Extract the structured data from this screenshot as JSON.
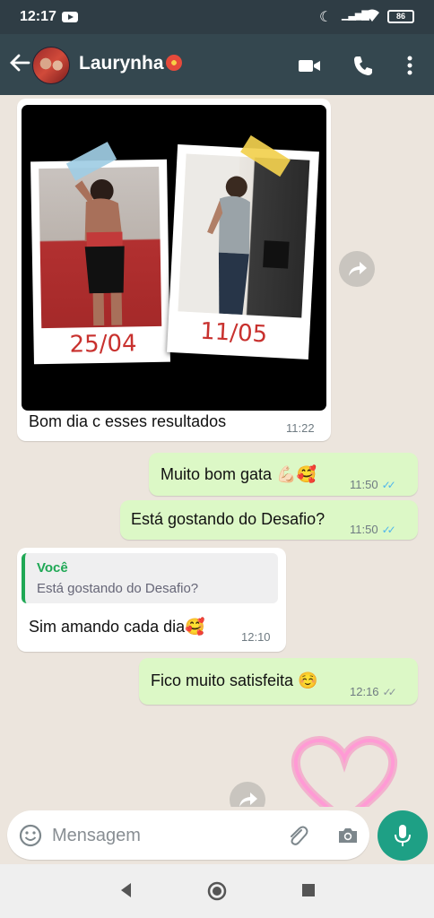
{
  "status_bar": {
    "time": "12:17",
    "battery": "86"
  },
  "header": {
    "contact_name": "Laurynha"
  },
  "messages": [
    {
      "caption": "Bom dia c esses resultados",
      "time": "11:22",
      "photo_labels": [
        "25/04",
        "11/05"
      ]
    },
    {
      "text": "Muito bom gata 💪🏻🥰",
      "time": "11:50"
    },
    {
      "text": "Está gostando do Desafio?",
      "time": "11:50"
    },
    {
      "quote_author": "Você",
      "quote_text": "Está gostando do Desafio?",
      "text": "Sim amando cada dia🥰",
      "time": "12:10"
    },
    {
      "text": "Fico muito satisfeita ☺️",
      "time": "12:16"
    }
  ],
  "input": {
    "placeholder": "Mensagem"
  },
  "colors": {
    "header": "#34474f",
    "status_bar": "#2f3d45",
    "outgoing_bubble": "#dcf8c6",
    "incoming_bubble": "#ffffff",
    "read_ticks": "#4fb6ec",
    "mic_button": "#1ea085",
    "quote_accent": "#1fa855"
  },
  "icons": [
    "youtube-icon",
    "moon-icon",
    "signal-icon",
    "wifi-icon",
    "battery-icon",
    "back-arrow-icon",
    "video-call-icon",
    "phone-icon",
    "more-options-icon",
    "forward-icon",
    "emoji-icon",
    "attach-icon",
    "camera-icon",
    "mic-icon",
    "nav-back-icon",
    "nav-home-icon",
    "nav-recents-icon"
  ]
}
